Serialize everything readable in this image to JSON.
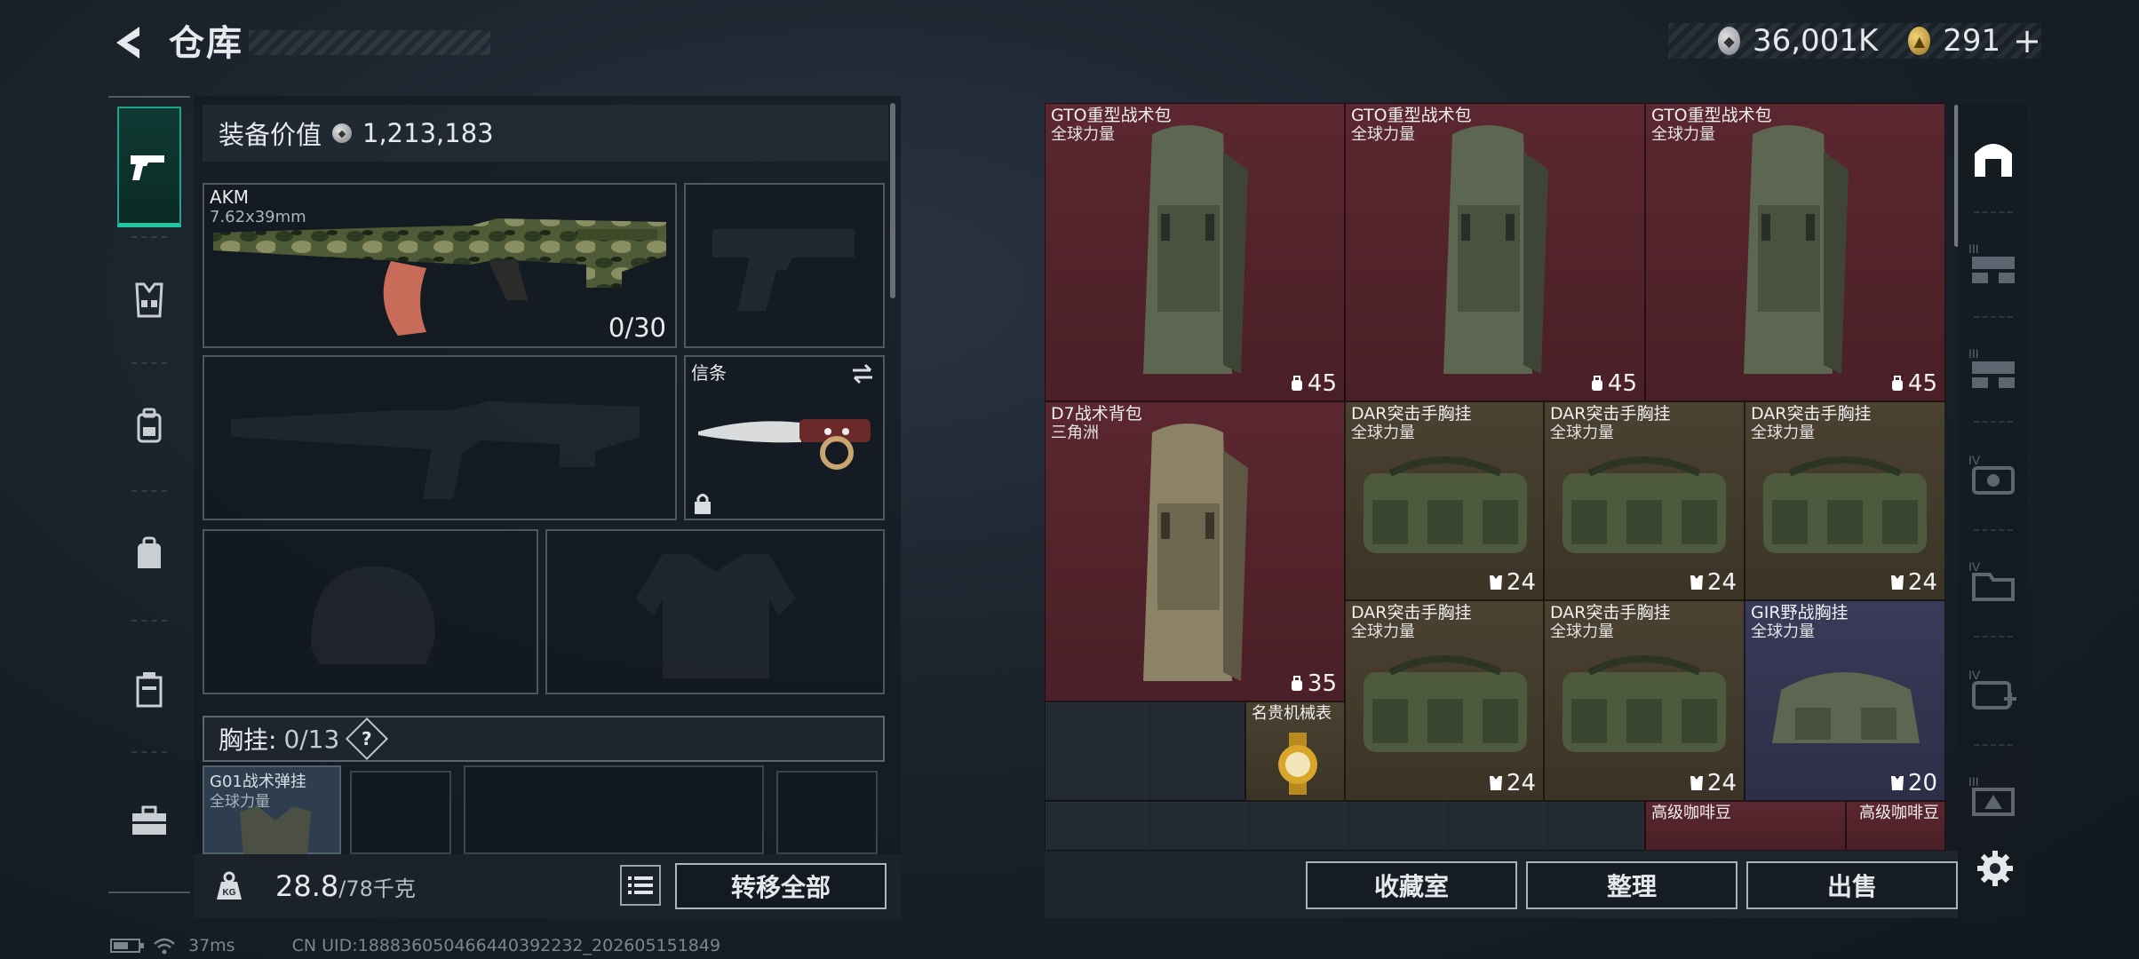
{
  "header": {
    "title": "仓库",
    "silver_amount": "36,001K",
    "gold_amount": "291",
    "plus_label": "+"
  },
  "left_rail": {
    "items": [
      {
        "icon": "pistol-icon",
        "active": true
      },
      {
        "icon": "chest-rig-icon",
        "active": false
      },
      {
        "icon": "backpack-icon",
        "active": false
      },
      {
        "icon": "bag-icon",
        "active": false
      },
      {
        "icon": "case-icon",
        "active": false
      },
      {
        "icon": "toolbox-icon",
        "active": false
      }
    ]
  },
  "loadout": {
    "equip_value_label": "装备价值",
    "equip_value": "1,213,183",
    "primary": {
      "name": "AKM",
      "caliber": "7.62x39mm",
      "ammo": "0/30"
    },
    "melee": {
      "name": "信条"
    },
    "chest_label": "胸挂:",
    "chest_count": "0/13",
    "chest_help": "?",
    "chest_item": {
      "name": "G01战术弹挂",
      "sub": "全球力量"
    },
    "weight_value": "28.8",
    "weight_max": "/78千克",
    "transfer_all": "转移全部"
  },
  "storage": {
    "items": [
      {
        "name": "GTO重型战术包",
        "sub": "全球力量",
        "cap": "45",
        "color": "red"
      },
      {
        "name": "GTO重型战术包",
        "sub": "全球力量",
        "cap": "45",
        "color": "red"
      },
      {
        "name": "GTO重型战术包",
        "sub": "全球力量",
        "cap": "45",
        "color": "red"
      },
      {
        "name": "D7战术背包",
        "sub": "三角洲",
        "cap": "35",
        "color": "red"
      },
      {
        "name": "DAR突击手胸挂",
        "sub": "全球力量",
        "cap": "24",
        "color": "brown"
      },
      {
        "name": "DAR突击手胸挂",
        "sub": "全球力量",
        "cap": "24",
        "color": "brown"
      },
      {
        "name": "DAR突击手胸挂",
        "sub": "全球力量",
        "cap": "24",
        "color": "brown"
      },
      {
        "name": "DAR突击手胸挂",
        "sub": "全球力量",
        "cap": "24",
        "color": "brown"
      },
      {
        "name": "DAR突击手胸挂",
        "sub": "全球力量",
        "cap": "24",
        "color": "brown"
      },
      {
        "name": "GIR野战胸挂",
        "sub": "全球力量",
        "cap": "20",
        "color": "purple"
      },
      {
        "name": "名贵机械表",
        "sub": "",
        "cap": "",
        "color": "brown"
      },
      {
        "name": "高级咖啡豆",
        "sub": "",
        "cap": "",
        "color": "red"
      },
      {
        "name": "高级咖啡豆",
        "sub": "",
        "cap": "",
        "color": "red"
      }
    ]
  },
  "bottom_actions": {
    "collection": "收藏室",
    "organize": "整理",
    "sell": "出售"
  },
  "status": {
    "ping": "37ms",
    "uid": "CN UID:18883605046644039​2232_202605151849"
  },
  "colors": {
    "accent": "#22c7a2",
    "red_cell": "#5b2730",
    "brown_cell": "#4a4131",
    "purple_cell": "#3a3a5a"
  }
}
